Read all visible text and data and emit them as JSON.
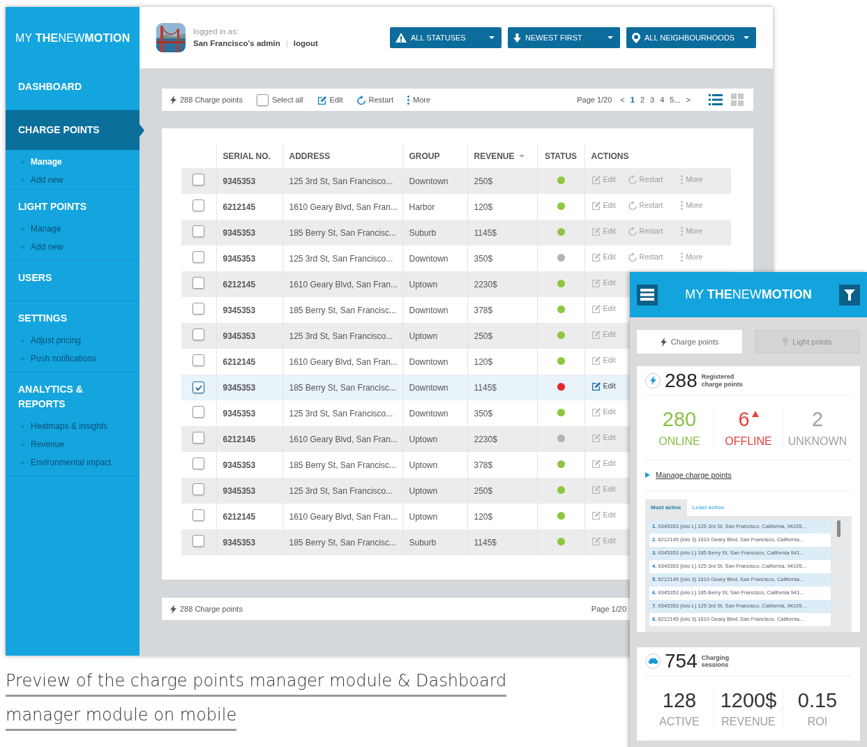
{
  "sidebar": {
    "logo": "MY **THE**NEW**MOTION**",
    "sections": [
      {
        "label": "DASHBOARD",
        "selected": false
      },
      {
        "label": "CHARGE POINTS",
        "selected": true,
        "items": [
          {
            "label": "Manage",
            "selected": true
          },
          {
            "label": "Add new",
            "selected": false
          }
        ]
      },
      {
        "label": "LIGHT POINTS",
        "selected": false,
        "items": [
          {
            "label": "Manage",
            "selected": false
          },
          {
            "label": "Add new",
            "selected": false
          }
        ]
      },
      {
        "label": "USERS",
        "selected": false
      },
      {
        "label": "SETTINGS",
        "selected": false,
        "items": [
          {
            "label": "Adjust pricing",
            "selected": false
          },
          {
            "label": "Push notifications",
            "selected": false
          }
        ]
      },
      {
        "label": "ANALYTICS & REPORTS",
        "selected": false,
        "items": [
          {
            "label": "Heatmaps & insights",
            "selected": false
          },
          {
            "label": "Revenue",
            "selected": false
          },
          {
            "label": "Environmental impact",
            "selected": false
          }
        ]
      }
    ]
  },
  "header": {
    "logged_in_label": "logged in as:",
    "user": "San Francisco's admin",
    "logout": "logout",
    "filters": [
      {
        "kind": "status",
        "label": "ALL STATUSES"
      },
      {
        "kind": "sort",
        "label": "NEWEST FIRST"
      },
      {
        "kind": "location",
        "label": "ALL NEIGHBOURHOODS"
      }
    ]
  },
  "toolbar": {
    "count": "288 Charge points",
    "select_all": {
      "label": "Select all",
      "checked": false
    },
    "actions": [
      {
        "kind": "edit",
        "label": "Edit"
      },
      {
        "kind": "restart",
        "label": "Restart"
      },
      {
        "kind": "more",
        "label": "More"
      }
    ],
    "page": "Page 1/20",
    "prev": "<",
    "pages": [
      {
        "label": "1",
        "selected": true
      },
      {
        "label": "2",
        "selected": false
      },
      {
        "label": "3",
        "selected": false
      },
      {
        "label": "4",
        "selected": false
      },
      {
        "label": "5...",
        "selected": false
      }
    ],
    "next": ">",
    "views": [
      {
        "kind": "list",
        "selected": true
      },
      {
        "kind": "grid",
        "selected": false
      }
    ]
  },
  "table": {
    "columns": [
      {
        "label": "SERIAL NO.",
        "sorted": false
      },
      {
        "label": "ADDRESS",
        "sorted": false
      },
      {
        "label": "GROUP",
        "sorted": false
      },
      {
        "label": "REVENUE",
        "sorted": true
      },
      {
        "label": "STATUS",
        "sorted": false
      },
      {
        "label": "ACTIONS",
        "sorted": false
      }
    ],
    "rows": [
      {
        "checked": false,
        "selected": false,
        "serial": "9345353",
        "address": "125 3rd St, San Francisco...",
        "group": "Downtown",
        "revenue": "250$",
        "color": "#8dc63f",
        "actions": [
          {
            "kind": "edit",
            "label": "Edit"
          },
          {
            "kind": "restart",
            "label": "Restart"
          },
          {
            "kind": "more",
            "label": "More"
          }
        ]
      },
      {
        "checked": false,
        "selected": false,
        "serial": "6212145",
        "address": "1610 Geary Blvd, San Fran...",
        "group": "Harbor",
        "revenue": "120$",
        "color": "#8dc63f",
        "actions": [
          {
            "kind": "edit",
            "label": "Edit"
          },
          {
            "kind": "restart",
            "label": "Restart"
          },
          {
            "kind": "more",
            "label": "More"
          }
        ]
      },
      {
        "checked": false,
        "selected": false,
        "serial": "9345353",
        "address": "185 Berry St, San Francisc...",
        "group": "Suburb",
        "revenue": "1145$",
        "color": "#8dc63f",
        "actions": [
          {
            "kind": "edit",
            "label": "Edit"
          },
          {
            "kind": "restart",
            "label": "Restart"
          },
          {
            "kind": "more",
            "label": "More"
          }
        ]
      },
      {
        "checked": false,
        "selected": false,
        "serial": "9345353",
        "address": "125 3rd St, San Francisco...",
        "group": "Downtown",
        "revenue": "350$",
        "color": "#b4b4b4",
        "actions": [
          {
            "kind": "edit",
            "label": "Edit"
          },
          {
            "kind": "restart",
            "label": "Restart"
          },
          {
            "kind": "more",
            "label": "More"
          }
        ]
      },
      {
        "checked": false,
        "selected": false,
        "serial": "6212145",
        "address": "1610 Geary Blvd, San Fran...",
        "group": "Uptown",
        "revenue": "2230$",
        "color": "#8dc63f",
        "actions": [
          {
            "kind": "edit",
            "label": "Edit"
          }
        ]
      },
      {
        "checked": false,
        "selected": false,
        "serial": "9345353",
        "address": "185 Berry St, San Francisc...",
        "group": "Downtown",
        "revenue": "378$",
        "color": "#8dc63f",
        "actions": [
          {
            "kind": "edit",
            "label": "Edit"
          }
        ]
      },
      {
        "checked": false,
        "selected": false,
        "serial": "9345353",
        "address": "125 3rd St, San Francisco...",
        "group": "Uptown",
        "revenue": "250$",
        "color": "#8dc63f",
        "actions": [
          {
            "kind": "edit",
            "label": "Edit"
          }
        ]
      },
      {
        "checked": false,
        "selected": false,
        "serial": "6212145",
        "address": "1610 Geary Blvd, San Fran...",
        "group": "Downtown",
        "revenue": "120$",
        "color": "#8dc63f",
        "actions": [
          {
            "kind": "edit",
            "label": "Edit"
          }
        ]
      },
      {
        "checked": true,
        "selected": true,
        "serial": "9345353",
        "address": "185 Berry St, San Francisc...",
        "group": "Downtown",
        "revenue": "1145$",
        "color": "#e8262a",
        "actions": [
          {
            "kind": "edit",
            "label": "Edit"
          }
        ]
      },
      {
        "checked": false,
        "selected": false,
        "serial": "9345353",
        "address": "125 3rd St, San Francisco...",
        "group": "Downtown",
        "revenue": "350$",
        "color": "#8dc63f",
        "actions": [
          {
            "kind": "edit",
            "label": "Edit"
          }
        ]
      },
      {
        "checked": false,
        "selected": false,
        "serial": "6212145",
        "address": "1610 Geary Blvd, San Fran...",
        "group": "Uptown",
        "revenue": "2230$",
        "color": "#b4b4b4",
        "actions": [
          {
            "kind": "edit",
            "label": "Edit"
          }
        ]
      },
      {
        "checked": false,
        "selected": false,
        "serial": "9345353",
        "address": "185 Berry St, San Francisc...",
        "group": "Uptown",
        "revenue": "378$",
        "color": "#8dc63f",
        "actions": [
          {
            "kind": "edit",
            "label": "Edit"
          }
        ]
      },
      {
        "checked": false,
        "selected": false,
        "serial": "9345353",
        "address": "125 3rd St, San Francisco...",
        "group": "Uptown",
        "revenue": "250$",
        "color": "#8dc63f",
        "actions": [
          {
            "kind": "edit",
            "label": "Edit"
          }
        ]
      },
      {
        "checked": false,
        "selected": false,
        "serial": "6212145",
        "address": "1610 Geary Blvd, San Fran...",
        "group": "Uptown",
        "revenue": "120$",
        "color": "#8dc63f",
        "actions": [
          {
            "kind": "edit",
            "label": "Edit"
          }
        ]
      },
      {
        "checked": false,
        "selected": false,
        "serial": "9345353",
        "address": "185 Berry St, San Francisc...",
        "group": "Suburb",
        "revenue": "1145$",
        "color": "#8dc63f",
        "actions": [
          {
            "kind": "edit",
            "label": "Edit"
          }
        ]
      }
    ]
  },
  "footer": {
    "count": "288 Charge points",
    "page": "Page 1/20"
  },
  "mobile": {
    "logo": "MY **THE**NEW**MOTION**",
    "tabs": [
      {
        "kind": "charge",
        "label": "Charge points",
        "selected": true
      },
      {
        "kind": "light",
        "label": "Light points",
        "selected": false
      }
    ],
    "charge_card": {
      "total": "288",
      "caption": "Registered charge points",
      "stats": [
        {
          "value": "280",
          "label": "ONLINE",
          "color": "#8cc04a",
          "alert": false
        },
        {
          "value": "6",
          "label": "OFFLINE",
          "color": "#e8403a",
          "alert": true
        },
        {
          "value": "2",
          "label": "UNKNOWN",
          "color": "#a0a0a0",
          "alert": false
        }
      ],
      "link": "Manage charge points",
      "list_tabs": [
        {
          "label": "Most active",
          "selected": true
        },
        {
          "label": "Least active",
          "selected": false
        }
      ],
      "list": [
        {
          "num": "1.",
          "text": "9345353 (lolo L) 125 3rd St, San Francisco, California, 94105..."
        },
        {
          "num": "2.",
          "text": "6212145 (lolo 3) 1610 Geary Blvd, San Francisco, California..."
        },
        {
          "num": "3.",
          "text": "9345353 (lolo L) 185 Berry St, San Francisco, California 941..."
        },
        {
          "num": "4.",
          "text": "9345353 (lolo L) 125 3rd St, San Francisco, California, 94105..."
        },
        {
          "num": "5.",
          "text": "6212145 (lolo 3) 1610 Geary Blvd, San Francisco, California..."
        },
        {
          "num": "6.",
          "text": "9345353 (lolo L) 185 Berry St, San Francisco, California 941..."
        },
        {
          "num": "7.",
          "text": "9345353 (lolo L) 125 3rd St, San Francisco, California, 94105..."
        },
        {
          "num": "8.",
          "text": "6212145 (lolo 3) 1610 Geary Blvd, San Francisco, California..."
        }
      ]
    },
    "sessions_card": {
      "total": "754",
      "caption": "Charging sessions",
      "stats": [
        {
          "value": "128",
          "label": "ACTIVE"
        },
        {
          "value": "1200$",
          "label": "REVENUE"
        },
        {
          "value": "0.15",
          "label": "ROI"
        }
      ]
    }
  },
  "caption": {
    "lines": [
      "Preview of the charge points manager module & Dashboard",
      "manager module on mobile"
    ]
  }
}
